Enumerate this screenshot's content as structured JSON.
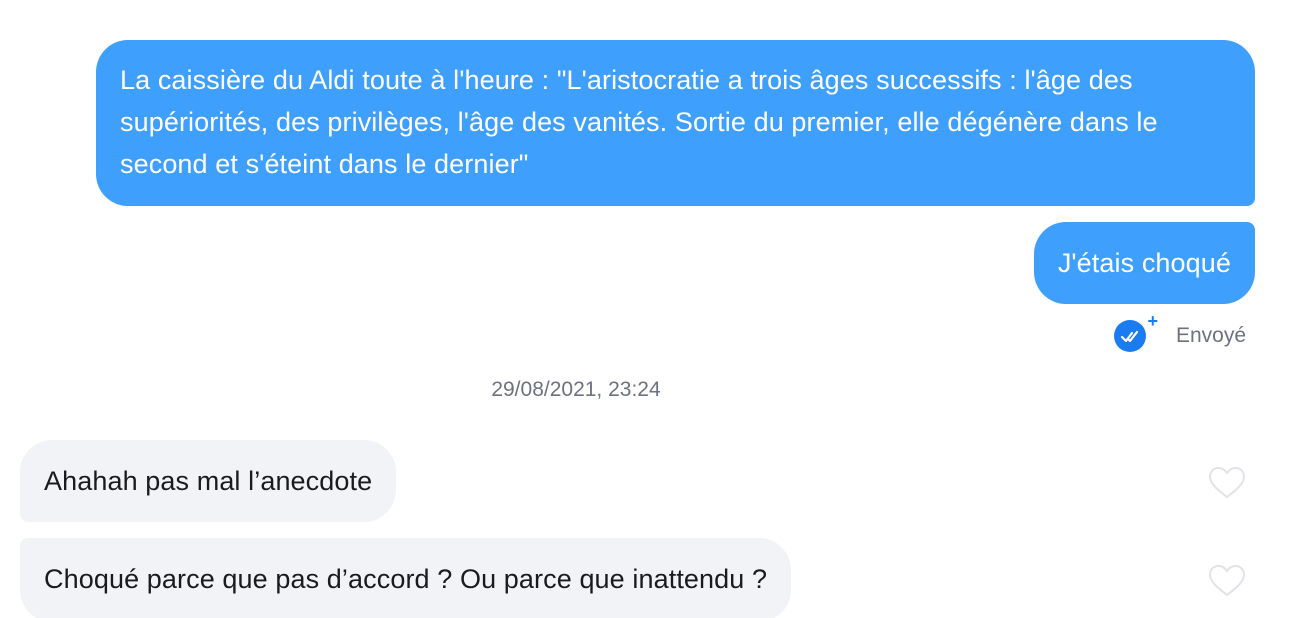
{
  "messages": {
    "outgoing": [
      {
        "text": "La caissière du Aldi toute à l'heure : \"L'aristocratie a trois âges successifs : l'âge des supériorités, des privilèges, l'âge des vanités. Sortie du premier, elle dégénère dans le second et s'éteint dans le dernier\""
      },
      {
        "text": "J'étais choqué"
      }
    ],
    "status": {
      "label": "Envoyé",
      "icon": "double-check-icon",
      "color": "#1b7cf2"
    },
    "timestamp": "29/08/2021, 23:24",
    "incoming": [
      {
        "text": "Ahahah pas mal l’anecdote",
        "like_icon": "heart-outline-icon"
      },
      {
        "text": "Choqué parce que pas d’accord ? Ou parce que inattendu ?",
        "like_icon": "heart-outline-icon"
      }
    ]
  },
  "colors": {
    "outgoing_bubble": "#3f9ffc",
    "incoming_bubble": "#f2f3f6",
    "meta_text": "#6b7280"
  }
}
